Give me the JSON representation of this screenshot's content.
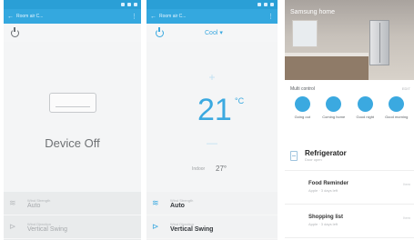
{
  "panel_off": {
    "appbar_title": "Room air C...",
    "status": "Device Off",
    "rows": [
      {
        "sub": "Wind Strength",
        "value": "Auto",
        "icon": "wind-icon"
      },
      {
        "sub": "Wind Direction",
        "value": "Vertical Swing",
        "icon": "swing-icon"
      }
    ]
  },
  "panel_on": {
    "appbar_title": "Room air C...",
    "mode": "Cool ▾",
    "plus": "+",
    "temperature": "21",
    "unit": "°C",
    "minus": "—",
    "indoor_label": "Indoor",
    "indoor_value": "27°",
    "rows": [
      {
        "sub": "Wind Strength",
        "value": "Auto",
        "icon": "wind-icon"
      },
      {
        "sub": "Wind Direction",
        "value": "Vertical Swing",
        "icon": "swing-icon"
      }
    ]
  },
  "panel_home": {
    "hero_title": "Samsung home",
    "multi_label": "Multi control",
    "multi_edit": "EDIT",
    "modes": [
      {
        "label": "Going out"
      },
      {
        "label": "Coming home"
      },
      {
        "label": "Good night"
      },
      {
        "label": "Good morning"
      }
    ],
    "device": {
      "name": "Refrigerator",
      "sub": "Door open"
    },
    "cards": [
      {
        "name": "Food Reminder",
        "sub": "Apple · 3 days left",
        "side": "Item"
      },
      {
        "name": "Shopping list",
        "sub": "Apple · 3 days left",
        "side": "Item"
      }
    ]
  }
}
